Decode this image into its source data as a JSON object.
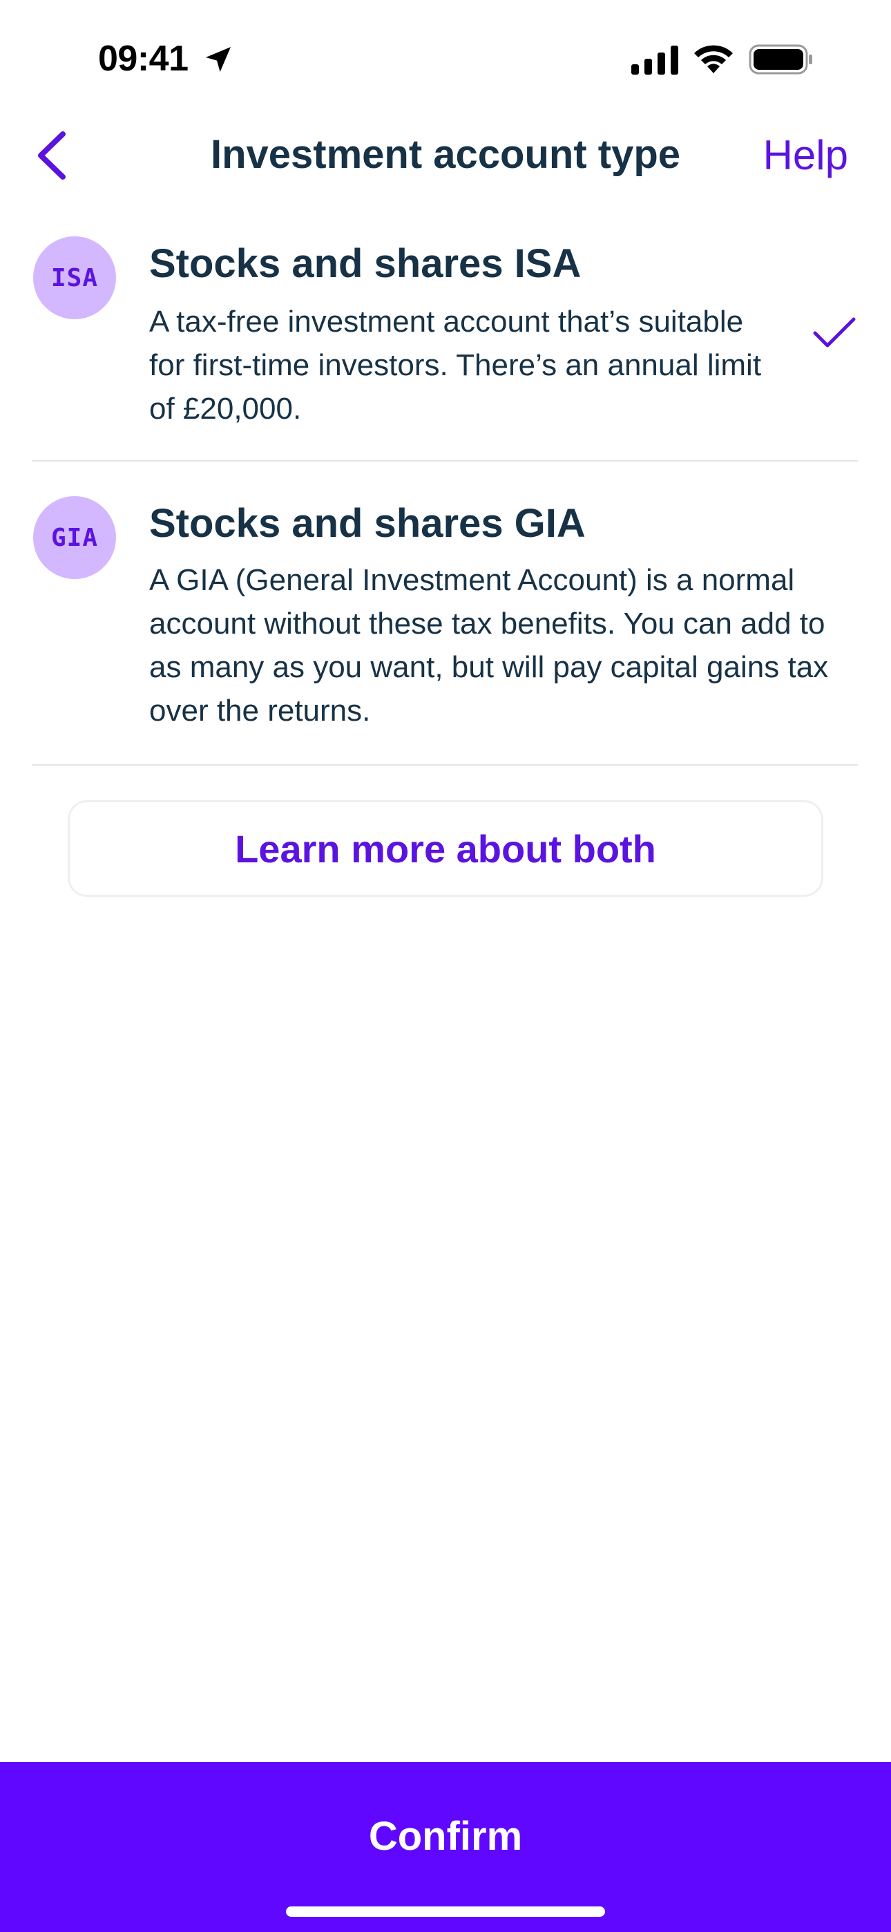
{
  "status_bar": {
    "time": "09:41",
    "icons": [
      "location-arrow-icon",
      "cellular-signal-icon",
      "wifi-icon",
      "battery-icon"
    ]
  },
  "nav": {
    "back_icon": "chevron-left-icon",
    "title": "Investment account type",
    "help_label": "Help"
  },
  "options": [
    {
      "badge": "ISA",
      "title": "Stocks and shares ISA",
      "description": "A tax-free investment account that’s suitable for first-time investors. There’s an annual limit of £20,000.",
      "selected": true
    },
    {
      "badge": "GIA",
      "title": "Stocks and shares GIA",
      "description": "A GIA (General Investment Account) is a normal account without these tax benefits. You can add to as many as you want, but will pay capital gains tax over the returns.",
      "selected": false
    }
  ],
  "learn_more_label": "Learn more about both",
  "confirm_label": "Confirm",
  "colors": {
    "accent": "#5b13e0",
    "confirm_background": "#6008ff",
    "badge_background": "#d3b8ff",
    "text_primary": "#173246",
    "divider": "#e4e4e8"
  }
}
